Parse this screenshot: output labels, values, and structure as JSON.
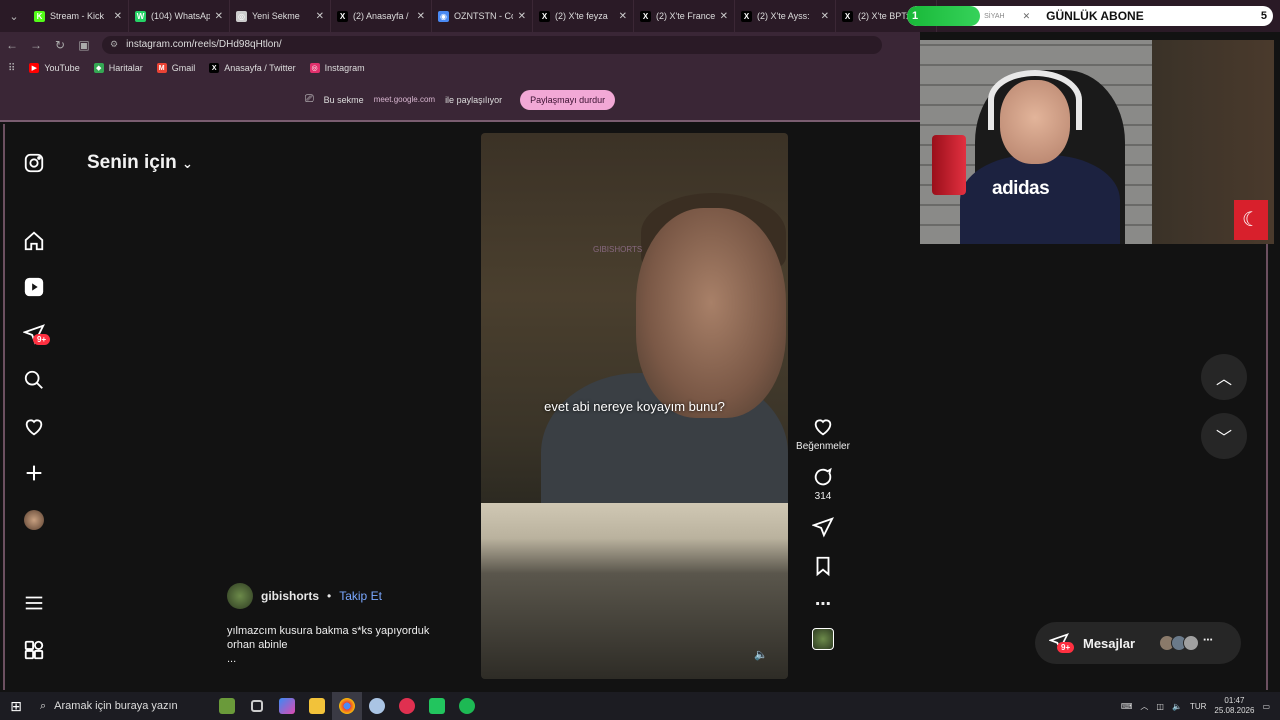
{
  "browser": {
    "tabs": [
      {
        "label": "Stream - Kick",
        "icon": "kick-icon",
        "color": "#53fc18",
        "glyph": "K"
      },
      {
        "label": "(104) WhatsApp",
        "icon": "whatsapp-icon",
        "color": "#25d366",
        "glyph": "W"
      },
      {
        "label": "Yeni Sekme",
        "icon": "chrome-icon",
        "color": "#cccccc",
        "glyph": "◎"
      },
      {
        "label": "(2) Anasayfa /",
        "icon": "x-icon",
        "color": "#000000",
        "glyph": "X"
      },
      {
        "label": "OZNTSTN - Co",
        "icon": "globe-icon",
        "color": "#4a8af4",
        "glyph": "◉"
      },
      {
        "label": "(2) X'te feyza",
        "icon": "x-icon",
        "color": "#000000",
        "glyph": "X"
      },
      {
        "label": "(2) X'te France",
        "icon": "x-icon",
        "color": "#000000",
        "glyph": "X"
      },
      {
        "label": "(2) X'te Ayss:",
        "icon": "x-icon",
        "color": "#000000",
        "glyph": "X"
      },
      {
        "label": "(2) X'te BPT:",
        "icon": "x-icon",
        "color": "#000000",
        "glyph": "X"
      }
    ],
    "url": "instagram.com/reels/DHd98qHtlon/",
    "bookmarks": [
      {
        "label": "YouTube",
        "icon": "youtube-icon",
        "color": "#ff0000",
        "glyph": "▶"
      },
      {
        "label": "Haritalar",
        "icon": "maps-icon",
        "color": "#34a853",
        "glyph": "◆"
      },
      {
        "label": "Gmail",
        "icon": "gmail-icon",
        "color": "#ea4335",
        "glyph": "M"
      },
      {
        "label": "Anasayfa / Twitter",
        "icon": "x-icon",
        "color": "#000000",
        "glyph": "X"
      },
      {
        "label": "Instagram",
        "icon": "instagram-icon",
        "color": "#e1306c",
        "glyph": "◎"
      }
    ]
  },
  "share": {
    "prefix": "Bu sekme",
    "domain": "meet.google.com",
    "suffix": "ile paylaşılıyor",
    "stop_label": "Paylaşmayı durdur"
  },
  "instagram": {
    "feed_title": "Senin için",
    "notif_badge": "9+",
    "reel": {
      "caption": "evet abi nereye koyayım bunu?",
      "watermark": "GIBISHORTS",
      "author": "gibishorts",
      "separator": "•",
      "follow_label": "Takip Et",
      "description_line1": "yılmazcım kusura bakma s*ks yapıyorduk",
      "description_line2": "orhan abinle",
      "more": "...",
      "likes_label": "Beğenmeler",
      "comments_count": "314"
    },
    "messages_label": "Mesajlar",
    "messages_badge": "9+"
  },
  "overlay": {
    "sub_count_left": "1",
    "sub_mid_text": "SİYAH",
    "sub_title": "GÜNLÜK ABONE",
    "sub_count_right": "5",
    "sub_progress": 0.2,
    "shirt_text": "adidas"
  },
  "taskbar": {
    "search_placeholder": "Aramak için buraya yazın",
    "lang": "TUR",
    "time": "01:47",
    "date": "25.08.2026"
  }
}
